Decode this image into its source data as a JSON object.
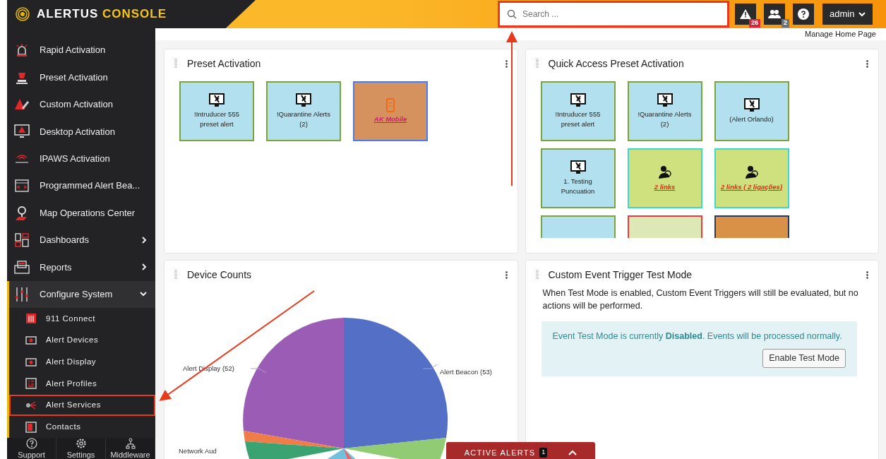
{
  "brand": {
    "name": "ALERTUS",
    "accent": "CONSOLE"
  },
  "search": {
    "placeholder": "Search ...",
    "highlighted": true
  },
  "header_buttons": [
    {
      "kind": "alerts",
      "badge": "26"
    },
    {
      "kind": "users",
      "badge": "2"
    },
    {
      "kind": "help"
    }
  ],
  "user_menu": {
    "label": "admin"
  },
  "sidebar": {
    "items": [
      {
        "label": "Rapid Activation",
        "kind": "link"
      },
      {
        "label": "Preset Activation",
        "kind": "link"
      },
      {
        "label": "Custom Activation",
        "kind": "link"
      },
      {
        "label": "Desktop Activation",
        "kind": "link"
      },
      {
        "label": "IPAWS Activation",
        "kind": "link"
      },
      {
        "label": "Programmed Alert Bea...",
        "kind": "link"
      },
      {
        "label": "Map Operations Center",
        "kind": "link"
      },
      {
        "label": "Dashboards",
        "kind": "group",
        "expanded": false
      },
      {
        "label": "Reports",
        "kind": "group",
        "expanded": false
      },
      {
        "label": "Configure System",
        "kind": "group",
        "expanded": true,
        "children": [
          {
            "label": "911 Connect",
            "highlighted": false
          },
          {
            "label": "Alert Devices",
            "highlighted": false
          },
          {
            "label": "Alert Display",
            "highlighted": false
          },
          {
            "label": "Alert Profiles",
            "highlighted": false
          },
          {
            "label": "Alert Services",
            "highlighted": true
          },
          {
            "label": "Contacts",
            "highlighted": false
          }
        ]
      }
    ],
    "footer": [
      {
        "label": "Support"
      },
      {
        "label": "Settings"
      },
      {
        "label": "Middleware"
      }
    ]
  },
  "manage_home_page": "Manage Home Page",
  "widgets": [
    {
      "title": "Preset Activation",
      "tiles": [
        {
          "kind": "preset",
          "label": "!Intruducer 555 preset alert"
        },
        {
          "kind": "preset",
          "label": "!Quarantine Alerts (2)"
        },
        {
          "kind": "mobile",
          "label": "AK Mobile"
        }
      ]
    },
    {
      "title": "Quick Access Preset Activation",
      "tiles": [
        {
          "kind": "preset",
          "label": "!Intruducer 555 preset alert"
        },
        {
          "kind": "preset",
          "label": "!Quarantine Alerts (2)"
        },
        {
          "kind": "preset",
          "label": "(Alert Orlando)"
        },
        {
          "kind": "preset",
          "label": "1. Testing Puncuation"
        },
        {
          "kind": "link",
          "label": "2 links"
        },
        {
          "kind": "link",
          "label": "2 links ( 2 ligações)"
        },
        {
          "kind": "preset"
        },
        {
          "kind": "picture"
        },
        {
          "kind": "orange"
        }
      ]
    },
    {
      "title": "Device Counts",
      "pie_labels": [
        "Alert Display (52)",
        "Alert Beacon (53)",
        "Network Aud"
      ]
    },
    {
      "title": "Custom Event Trigger Test Mode",
      "description": "When Test Mode is enabled, Custom Event Triggers will still be evaluated, but no actions will be performed.",
      "status": "Event Test Mode is currently **Disabled**. Events will be processed normally.",
      "button": "Enable Test Mode"
    }
  ],
  "active_alerts": {
    "label": "ACTIVE ALERTS",
    "count": "1"
  }
}
